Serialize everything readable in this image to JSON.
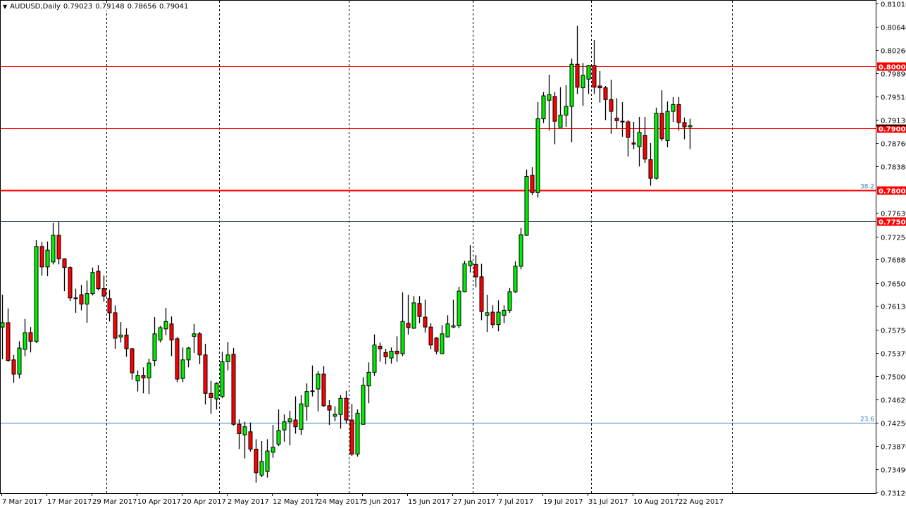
{
  "header": {
    "symbol": "AUDUSD,Daily",
    "open": "0.79023",
    "high": "0.79148",
    "low": "0.78656",
    "close": "0.79041",
    "menu_icon": "triangle-down-icon"
  },
  "colors": {
    "bull": "#00ee00",
    "bear": "#ff0000",
    "level": "#ff0000",
    "fibo": "#3a7fc0",
    "grid": "#000000"
  },
  "axis": {
    "price_min": 0.7312,
    "price_max": 0.8101,
    "ticks": [
      "0.81010",
      "0.80640",
      "0.80260",
      "0.79890",
      "0.79510",
      "0.79130",
      "0.78760",
      "0.78380",
      "0.77630",
      "0.77250",
      "0.76880",
      "0.76500",
      "0.76130",
      "0.75750",
      "0.75370",
      "0.75000",
      "0.74620",
      "0.74250",
      "0.73870",
      "0.73490",
      "0.73120"
    ],
    "date_labels": [
      "7 Mar 2017",
      "17 Mar 2017",
      "29 Mar 2017",
      "10 Apr 2017",
      "20 Apr 2017",
      "2 May 2017",
      "12 May 2017",
      "24 May 2017",
      "5 Jun 2017",
      "15 Jun 2017",
      "27 Jun 2017",
      "7 Jul 2017",
      "19 Jul 2017",
      "31 Jul 2017",
      "10 Aug 2017",
      "22 Aug 2017"
    ],
    "date_label_every_bars": 8,
    "period_separator_bars": [
      19,
      39,
      62,
      84,
      105,
      130
    ]
  },
  "levels": [
    {
      "price": 0.8,
      "label": "0.80000",
      "color": "#ff0000"
    },
    {
      "price": 0.79,
      "label": "0.79000",
      "color": "#ff0000"
    },
    {
      "price": 0.78,
      "label": "0.78000",
      "color": "#ff0000"
    },
    {
      "price": 0.775,
      "label": "0.77500",
      "color": "#ff0000"
    }
  ],
  "fibo": [
    {
      "price": 0.78,
      "label": "38.2"
    },
    {
      "price": 0.7425,
      "label": "23.6"
    }
  ],
  "chart_data": {
    "type": "candlestick",
    "title": "AUDUSD,Daily",
    "columns": [
      "open",
      "high",
      "low",
      "close"
    ],
    "candles": [
      [
        0.7579,
        0.7631,
        0.7527,
        0.7586
      ],
      [
        0.7586,
        0.7609,
        0.7523,
        0.7525
      ],
      [
        0.7526,
        0.7534,
        0.7489,
        0.7503
      ],
      [
        0.7503,
        0.7556,
        0.7496,
        0.7545
      ],
      [
        0.7543,
        0.7592,
        0.7532,
        0.757
      ],
      [
        0.757,
        0.7579,
        0.7538,
        0.7556
      ],
      [
        0.7556,
        0.7719,
        0.7553,
        0.7709
      ],
      [
        0.7709,
        0.7716,
        0.7662,
        0.7676
      ],
      [
        0.7676,
        0.7717,
        0.7661,
        0.7703
      ],
      [
        0.7684,
        0.7747,
        0.768,
        0.7727
      ],
      [
        0.7727,
        0.7749,
        0.768,
        0.7689
      ],
      [
        0.7689,
        0.769,
        0.7637,
        0.7675
      ],
      [
        0.7675,
        0.7677,
        0.7621,
        0.7626
      ],
      [
        0.7626,
        0.7641,
        0.7602,
        0.7625
      ],
      [
        0.7631,
        0.7647,
        0.7606,
        0.7616
      ],
      [
        0.7616,
        0.7654,
        0.7586,
        0.7633
      ],
      [
        0.7633,
        0.7675,
        0.763,
        0.7667
      ],
      [
        0.7669,
        0.7679,
        0.7638,
        0.7641
      ],
      [
        0.7641,
        0.7662,
        0.762,
        0.7629
      ],
      [
        0.7625,
        0.7639,
        0.7588,
        0.7602
      ],
      [
        0.7602,
        0.7614,
        0.7544,
        0.7561
      ],
      [
        0.7563,
        0.7587,
        0.7554,
        0.7566
      ],
      [
        0.7566,
        0.7577,
        0.7531,
        0.7544
      ],
      [
        0.7544,
        0.7545,
        0.7494,
        0.7505
      ],
      [
        0.7492,
        0.7509,
        0.7475,
        0.7501
      ],
      [
        0.7501,
        0.7514,
        0.7472,
        0.7497
      ],
      [
        0.7497,
        0.7528,
        0.7471,
        0.7521
      ],
      [
        0.7525,
        0.7595,
        0.7516,
        0.7568
      ],
      [
        0.7558,
        0.7581,
        0.7554,
        0.7578
      ],
      [
        0.7576,
        0.761,
        0.7566,
        0.7588
      ],
      [
        0.7584,
        0.7596,
        0.7532,
        0.7558
      ],
      [
        0.756,
        0.7563,
        0.749,
        0.7495
      ],
      [
        0.7496,
        0.7546,
        0.749,
        0.7526
      ],
      [
        0.7526,
        0.7547,
        0.7514,
        0.7545
      ],
      [
        0.7564,
        0.7584,
        0.7537,
        0.7568
      ],
      [
        0.7568,
        0.7571,
        0.7519,
        0.7534
      ],
      [
        0.7534,
        0.7552,
        0.7454,
        0.7472
      ],
      [
        0.7472,
        0.7492,
        0.7439,
        0.7465
      ],
      [
        0.7463,
        0.749,
        0.7446,
        0.7488
      ],
      [
        0.7467,
        0.7539,
        0.7464,
        0.7523
      ],
      [
        0.7523,
        0.7555,
        0.7509,
        0.7534
      ],
      [
        0.7535,
        0.7545,
        0.742,
        0.7422
      ],
      [
        0.7422,
        0.743,
        0.7382,
        0.7407
      ],
      [
        0.7405,
        0.7426,
        0.7367,
        0.7418
      ],
      [
        0.741,
        0.7425,
        0.7378,
        0.7382
      ],
      [
        0.7382,
        0.7398,
        0.7328,
        0.7344
      ],
      [
        0.734,
        0.7395,
        0.7337,
        0.7362
      ],
      [
        0.7346,
        0.7398,
        0.7336,
        0.7379
      ],
      [
        0.7377,
        0.7421,
        0.7368,
        0.7385
      ],
      [
        0.739,
        0.7446,
        0.7387,
        0.7412
      ],
      [
        0.7413,
        0.7438,
        0.7394,
        0.7426
      ],
      [
        0.7426,
        0.7444,
        0.7388,
        0.7431
      ],
      [
        0.7429,
        0.7467,
        0.7407,
        0.7418
      ],
      [
        0.7414,
        0.7469,
        0.7405,
        0.7455
      ],
      [
        0.7451,
        0.7488,
        0.7428,
        0.7475
      ],
      [
        0.7475,
        0.7517,
        0.7467,
        0.7476
      ],
      [
        0.7479,
        0.7508,
        0.7443,
        0.7503
      ],
      [
        0.7503,
        0.7516,
        0.745,
        0.7452
      ],
      [
        0.7452,
        0.7461,
        0.7421,
        0.7445
      ],
      [
        0.7435,
        0.7451,
        0.7427,
        0.7438
      ],
      [
        0.7438,
        0.7469,
        0.7415,
        0.7464
      ],
      [
        0.7464,
        0.7476,
        0.7423,
        0.7429
      ],
      [
        0.7429,
        0.7455,
        0.7371,
        0.7374
      ],
      [
        0.7374,
        0.7446,
        0.737,
        0.744
      ],
      [
        0.7422,
        0.7498,
        0.7422,
        0.7485
      ],
      [
        0.7484,
        0.7522,
        0.7456,
        0.7506
      ],
      [
        0.7506,
        0.7567,
        0.75,
        0.755
      ],
      [
        0.7548,
        0.7554,
        0.7523,
        0.7544
      ],
      [
        0.7538,
        0.7544,
        0.7519,
        0.7531
      ],
      [
        0.7529,
        0.7546,
        0.752,
        0.754
      ],
      [
        0.754,
        0.7564,
        0.7523,
        0.7536
      ],
      [
        0.7536,
        0.7635,
        0.7532,
        0.7588
      ],
      [
        0.7585,
        0.7631,
        0.7567,
        0.7578
      ],
      [
        0.7577,
        0.7629,
        0.7576,
        0.7618
      ],
      [
        0.7617,
        0.7629,
        0.7585,
        0.7596
      ],
      [
        0.7595,
        0.7623,
        0.757,
        0.7579
      ],
      [
        0.7579,
        0.7585,
        0.7543,
        0.755
      ],
      [
        0.7561,
        0.7563,
        0.7535,
        0.754
      ],
      [
        0.7536,
        0.7582,
        0.7536,
        0.7568
      ],
      [
        0.7563,
        0.7598,
        0.7562,
        0.7584
      ],
      [
        0.7579,
        0.7623,
        0.7577,
        0.7581
      ],
      [
        0.7581,
        0.7644,
        0.7577,
        0.7637
      ],
      [
        0.7636,
        0.7686,
        0.7635,
        0.7681
      ],
      [
        0.7678,
        0.7711,
        0.7667,
        0.7685
      ],
      [
        0.768,
        0.7695,
        0.7643,
        0.766
      ],
      [
        0.766,
        0.7681,
        0.759,
        0.7604
      ],
      [
        0.7598,
        0.7631,
        0.7571,
        0.7602
      ],
      [
        0.7603,
        0.7614,
        0.7577,
        0.7583
      ],
      [
        0.7583,
        0.7622,
        0.7572,
        0.7603
      ],
      [
        0.7598,
        0.7614,
        0.7585,
        0.7606
      ],
      [
        0.7606,
        0.7642,
        0.7602,
        0.7636
      ],
      [
        0.7636,
        0.7685,
        0.7634,
        0.7677
      ],
      [
        0.7677,
        0.7739,
        0.7672,
        0.7728
      ],
      [
        0.7727,
        0.7833,
        0.7726,
        0.7822
      ],
      [
        0.7824,
        0.7837,
        0.7792,
        0.7796
      ],
      [
        0.7796,
        0.7942,
        0.7788,
        0.7915
      ],
      [
        0.7915,
        0.7958,
        0.7908,
        0.7952
      ],
      [
        0.7945,
        0.7986,
        0.7896,
        0.7954
      ],
      [
        0.7951,
        0.7958,
        0.7874,
        0.7911
      ],
      [
        0.7901,
        0.7966,
        0.7901,
        0.7921
      ],
      [
        0.7921,
        0.7969,
        0.7902,
        0.7935
      ],
      [
        0.7935,
        0.8012,
        0.7877,
        0.8003
      ],
      [
        0.8003,
        0.8065,
        0.7955,
        0.7966
      ],
      [
        0.7965,
        0.8005,
        0.7936,
        0.7985
      ],
      [
        0.7979,
        0.8002,
        0.7955,
        0.8001
      ],
      [
        0.8001,
        0.8042,
        0.7955,
        0.7966
      ],
      [
        0.7968,
        0.7992,
        0.7941,
        0.7965
      ],
      [
        0.7965,
        0.7968,
        0.7913,
        0.7946
      ],
      [
        0.7946,
        0.7978,
        0.7891,
        0.7927
      ],
      [
        0.7916,
        0.7948,
        0.7899,
        0.7912
      ],
      [
        0.7911,
        0.7942,
        0.7886,
        0.791
      ],
      [
        0.791,
        0.7913,
        0.7854,
        0.7885
      ],
      [
        0.7876,
        0.791,
        0.7866,
        0.7874
      ],
      [
        0.787,
        0.7918,
        0.7838,
        0.7893
      ],
      [
        0.7888,
        0.7918,
        0.7844,
        0.785
      ],
      [
        0.7849,
        0.7876,
        0.7807,
        0.7819
      ],
      [
        0.7819,
        0.7933,
        0.7817,
        0.7924
      ],
      [
        0.7924,
        0.7961,
        0.7879,
        0.7883
      ],
      [
        0.788,
        0.7943,
        0.7869,
        0.7927
      ],
      [
        0.7927,
        0.795,
        0.791,
        0.7938
      ],
      [
        0.7938,
        0.795,
        0.7896,
        0.7909
      ],
      [
        0.7909,
        0.7917,
        0.7882,
        0.7902
      ],
      [
        0.7902,
        0.7915,
        0.7866,
        0.7904
      ]
    ]
  }
}
